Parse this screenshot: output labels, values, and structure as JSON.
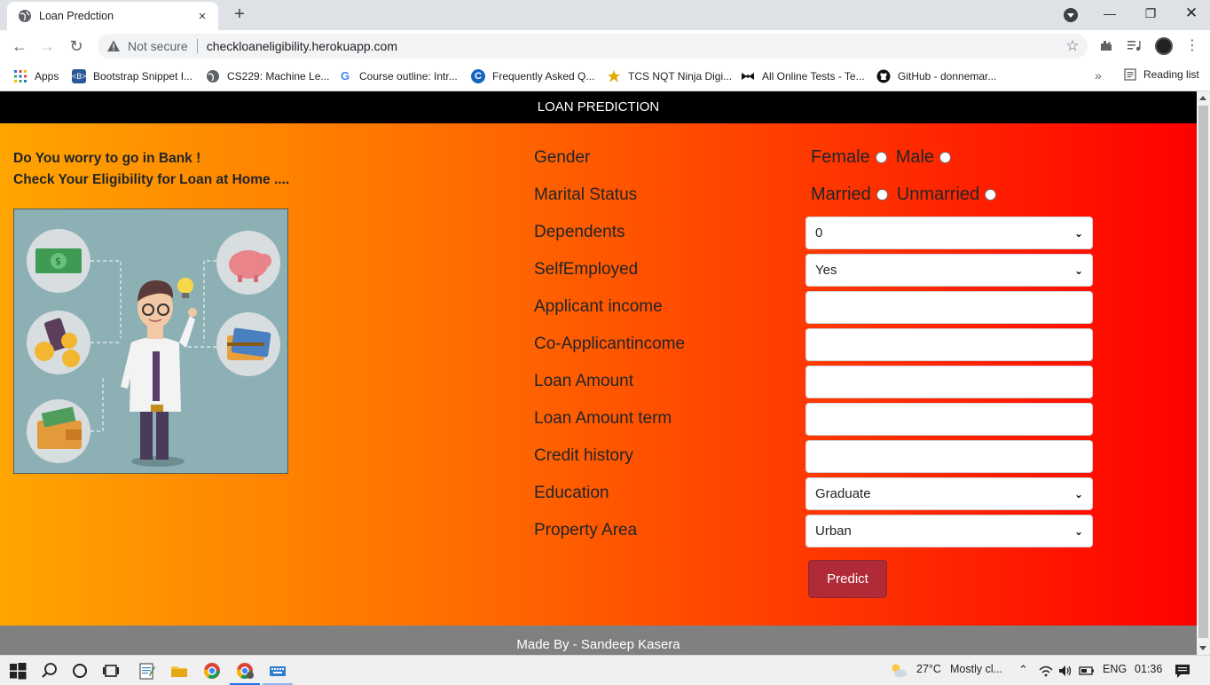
{
  "browser": {
    "tab_title": "Loan Predction",
    "security_label": "Not secure",
    "url": "checkloaneligibility.herokuapp.com",
    "new_tab_symbol": "+",
    "close_symbol": "×",
    "bookmarks": [
      {
        "label": "Apps",
        "icon": "apps-grid-icon"
      },
      {
        "label": "Bootstrap Snippet I...",
        "icon": "bootstrap-icon"
      },
      {
        "label": "CS229: Machine Le...",
        "icon": "globe-icon"
      },
      {
        "label": "Course outline: Intr...",
        "icon": "google-icon"
      },
      {
        "label": "Frequently Asked Q...",
        "icon": "c-logo-icon"
      },
      {
        "label": "TCS NQT Ninja Digi...",
        "icon": "tcs-icon"
      },
      {
        "label": "All Online Tests - Te...",
        "icon": "bowtie-icon"
      },
      {
        "label": "GitHub - donnemar...",
        "icon": "github-icon"
      }
    ],
    "more_bookmarks": "»",
    "reading_list": "Reading list"
  },
  "page": {
    "nav_title": "LOAN PREDICTION",
    "tagline_line1": "Do You worry to go in Bank !",
    "tagline_line2": "Check Your Eligibility for Loan at Home ....",
    "form": {
      "gender_label": "Gender",
      "gender_options": [
        "Female",
        "Male"
      ],
      "marital_label": "Marital Status",
      "marital_options": [
        "Married",
        "Unmarried"
      ],
      "dependents_label": "Dependents",
      "dependents_value": "0",
      "self_employed_label": "SelfEmployed",
      "self_employed_value": "Yes",
      "applicant_income_label": "Applicant income",
      "coapplicant_income_label": "Co-Applicantincome",
      "loan_amount_label": "Loan Amount",
      "loan_term_label": "Loan Amount term",
      "credit_history_label": "Credit history",
      "education_label": "Education",
      "education_value": "Graduate",
      "property_area_label": "Property Area",
      "property_area_value": "Urban",
      "predict_label": "Predict"
    },
    "footer": "Made By - Sandeep Kasera"
  },
  "taskbar": {
    "weather_temp": "27°C",
    "weather_desc": "Mostly cl...",
    "language": "ENG",
    "time": "01:36"
  },
  "colors": {
    "gradient_start": "#ffa500",
    "gradient_end": "#ff0000",
    "predict_button": "#b02a37",
    "navbar": "#000000",
    "footer": "#808080"
  }
}
